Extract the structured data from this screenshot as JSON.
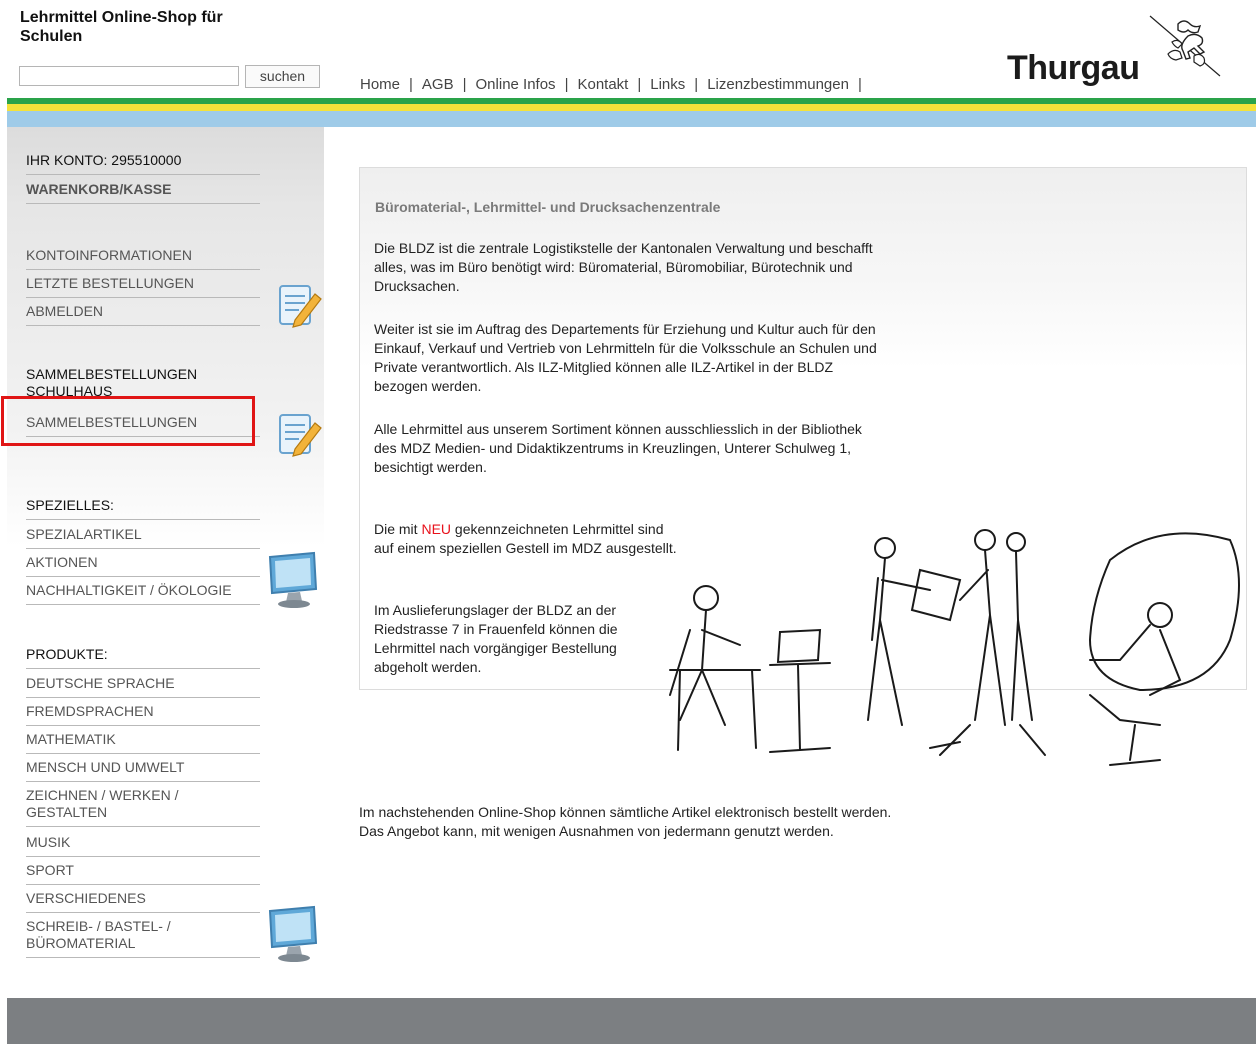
{
  "header": {
    "site_title": "Lehrmittel Online-Shop für Schulen",
    "search_value": "",
    "search_button": "suchen",
    "logo_text": "Thurgau"
  },
  "nav": [
    "Home",
    "AGB",
    "Online Infos",
    "Kontakt",
    "Links",
    "Lizenzbestimmungen"
  ],
  "sidebar": {
    "account": "IHR KONTO: 295510000",
    "cart": "WARENKORB/KASSE",
    "account_links": [
      "KONTOINFORMATIONEN",
      "LETZTE BESTELLUNGEN",
      "ABMELDEN"
    ],
    "group_heading": "SAMMELBESTELLUNGEN SCHULHAUS",
    "group_link": "SAMMELBESTELLUNGEN",
    "special_heading": "SPEZIELLES:",
    "special_links": [
      "SPEZIALARTIKEL",
      "AKTIONEN",
      "NACHHALTIGKEIT / ÖKOLOGIE"
    ],
    "products_heading": "PRODUKTE:",
    "product_links": [
      "DEUTSCHE SPRACHE",
      "FREMDSPRACHEN",
      "MATHEMATIK",
      "MENSCH UND UMWELT",
      "ZEICHNEN / WERKEN / GESTALTEN",
      "MUSIK",
      "SPORT",
      "VERSCHIEDENES",
      "SCHREIB- / BASTEL- / BÜROMATERIAL"
    ]
  },
  "content": {
    "title": "Büromaterial-, Lehrmittel- und Drucksachenzentrale",
    "p1": "Die BLDZ ist die zentrale Logistikstelle der Kantonalen Verwaltung und beschafft alles, was im Büro benötigt wird: Büromaterial, Büromobiliar, Bürotechnik und Drucksachen.",
    "p2": "Weiter ist sie im Auftrag des Departements für Erziehung und Kultur auch für den Einkauf, Verkauf und Vertrieb von Lehrmitteln für die Volksschule an Schulen und Private verantwortlich. Als ILZ-Mitglied können alle ILZ-Artikel in der BLDZ bezogen werden.",
    "p3": "Alle Lehrmittel aus unserem Sortiment können ausschliesslich in der Bibliothek des MDZ Medien- und Didaktikzentrums in Kreuzlingen, Unterer Schulweg 1, besichtigt werden.",
    "p4_before": "Die mit ",
    "p4_new": "NEU",
    "p4_after": " gekennzeichneten Lehrmittel sind auf einem speziellen Gestell  im MDZ ausgestellt.",
    "p5": "Im Auslieferungslager der BLDZ an der Riedstrasse 7 in Frauenfeld können die Lehrmittel nach vorgängiger Bestellung abgeholt werden.",
    "bottom_line1": "Im nachstehenden Online-Shop können sämtliche Artikel elektronisch bestellt werden.",
    "bottom_line2": "Das Angebot kann, mit wenigen Ausnahmen von jedermann genutzt werden."
  },
  "colors": {
    "stripe_green": "#2aa34a",
    "stripe_yellow": "#f4e23a",
    "stripe_blue": "#9fcbe8",
    "highlight": "#e01515",
    "new_label": "#e8111b",
    "footer": "#7c7f82"
  }
}
